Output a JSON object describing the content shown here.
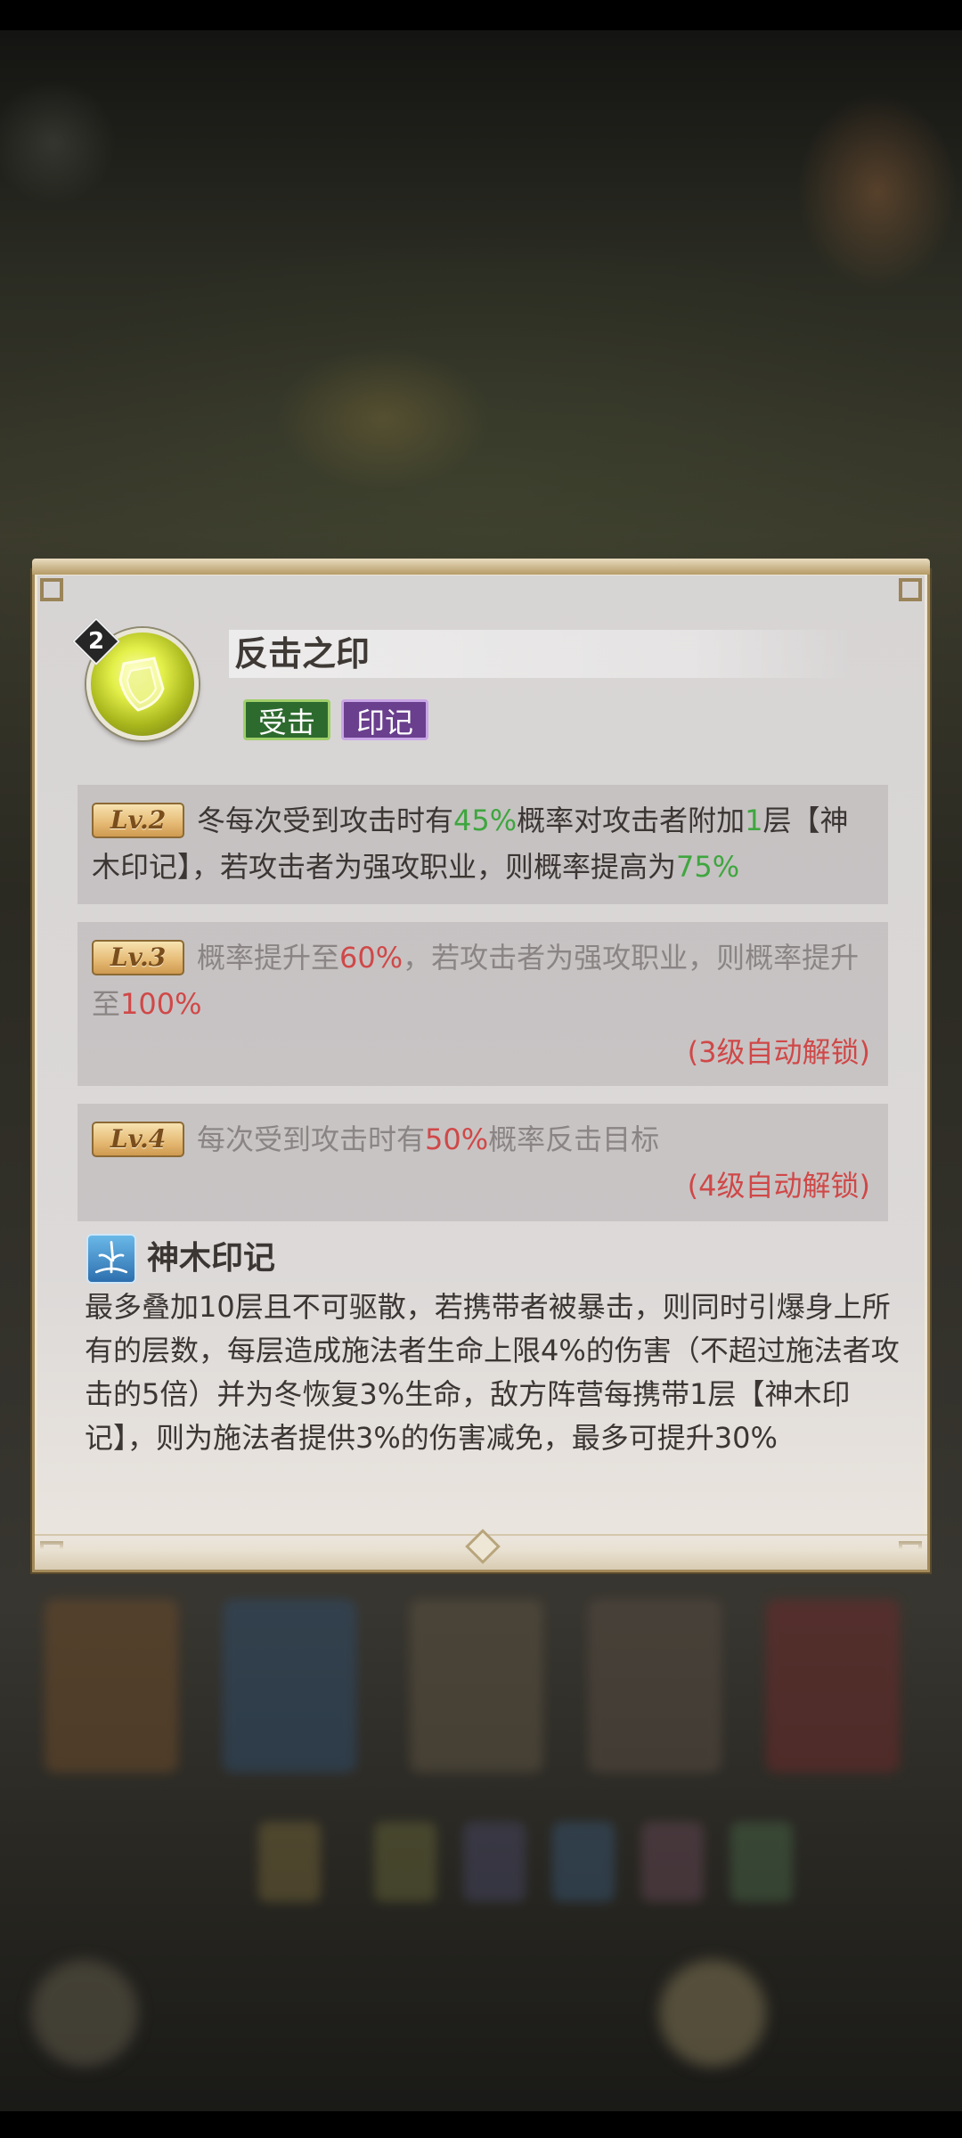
{
  "skill": {
    "level_badge": "2",
    "title": "反击之印",
    "tags": [
      "受击",
      "印记"
    ],
    "icon": "shield-icon"
  },
  "levels": [
    {
      "badge": "Lv.2",
      "segments": [
        {
          "t": "冬每次受到攻击时有",
          "c": "normal"
        },
        {
          "t": "45%",
          "c": "green"
        },
        {
          "t": "概率对攻击者附加",
          "c": "normal"
        },
        {
          "t": "1",
          "c": "green"
        },
        {
          "t": "层【神木印记】，若攻击者为强攻职业，则概率提高为",
          "c": "normal"
        },
        {
          "t": "75%",
          "c": "green"
        }
      ],
      "unlock": ""
    },
    {
      "badge": "Lv.3",
      "segments": [
        {
          "t": "概率提升至",
          "c": "dim"
        },
        {
          "t": "60%",
          "c": "red"
        },
        {
          "t": "，若攻击者为强攻职业，则概率提升至",
          "c": "dim"
        },
        {
          "t": "100%",
          "c": "red"
        }
      ],
      "unlock": "(3级自动解锁)"
    },
    {
      "badge": "Lv.4",
      "segments": [
        {
          "t": "每次受到攻击时有",
          "c": "dim"
        },
        {
          "t": "50%",
          "c": "red"
        },
        {
          "t": "概率反击目标",
          "c": "dim"
        }
      ],
      "unlock": "(4级自动解锁)"
    }
  ],
  "effect": {
    "icon": "tree-mark-icon",
    "title": "神木印记",
    "description": "最多叠加10层且不可驱散，若携带者被暴击，则同时引爆身上所有的层数，每层造成施法者生命上限4%的伤害（不超过施法者攻击的5倍）并为冬恢复3%生命，敌方阵营每携带1层【神木印记】，则为施法者提供3%的伤害减免，最多可提升30%"
  },
  "colors": {
    "highlight_green": "#3fa63f",
    "highlight_red": "#d04848",
    "tag_hit": "#2d6a2e",
    "tag_mark": "#6a3f8e"
  }
}
